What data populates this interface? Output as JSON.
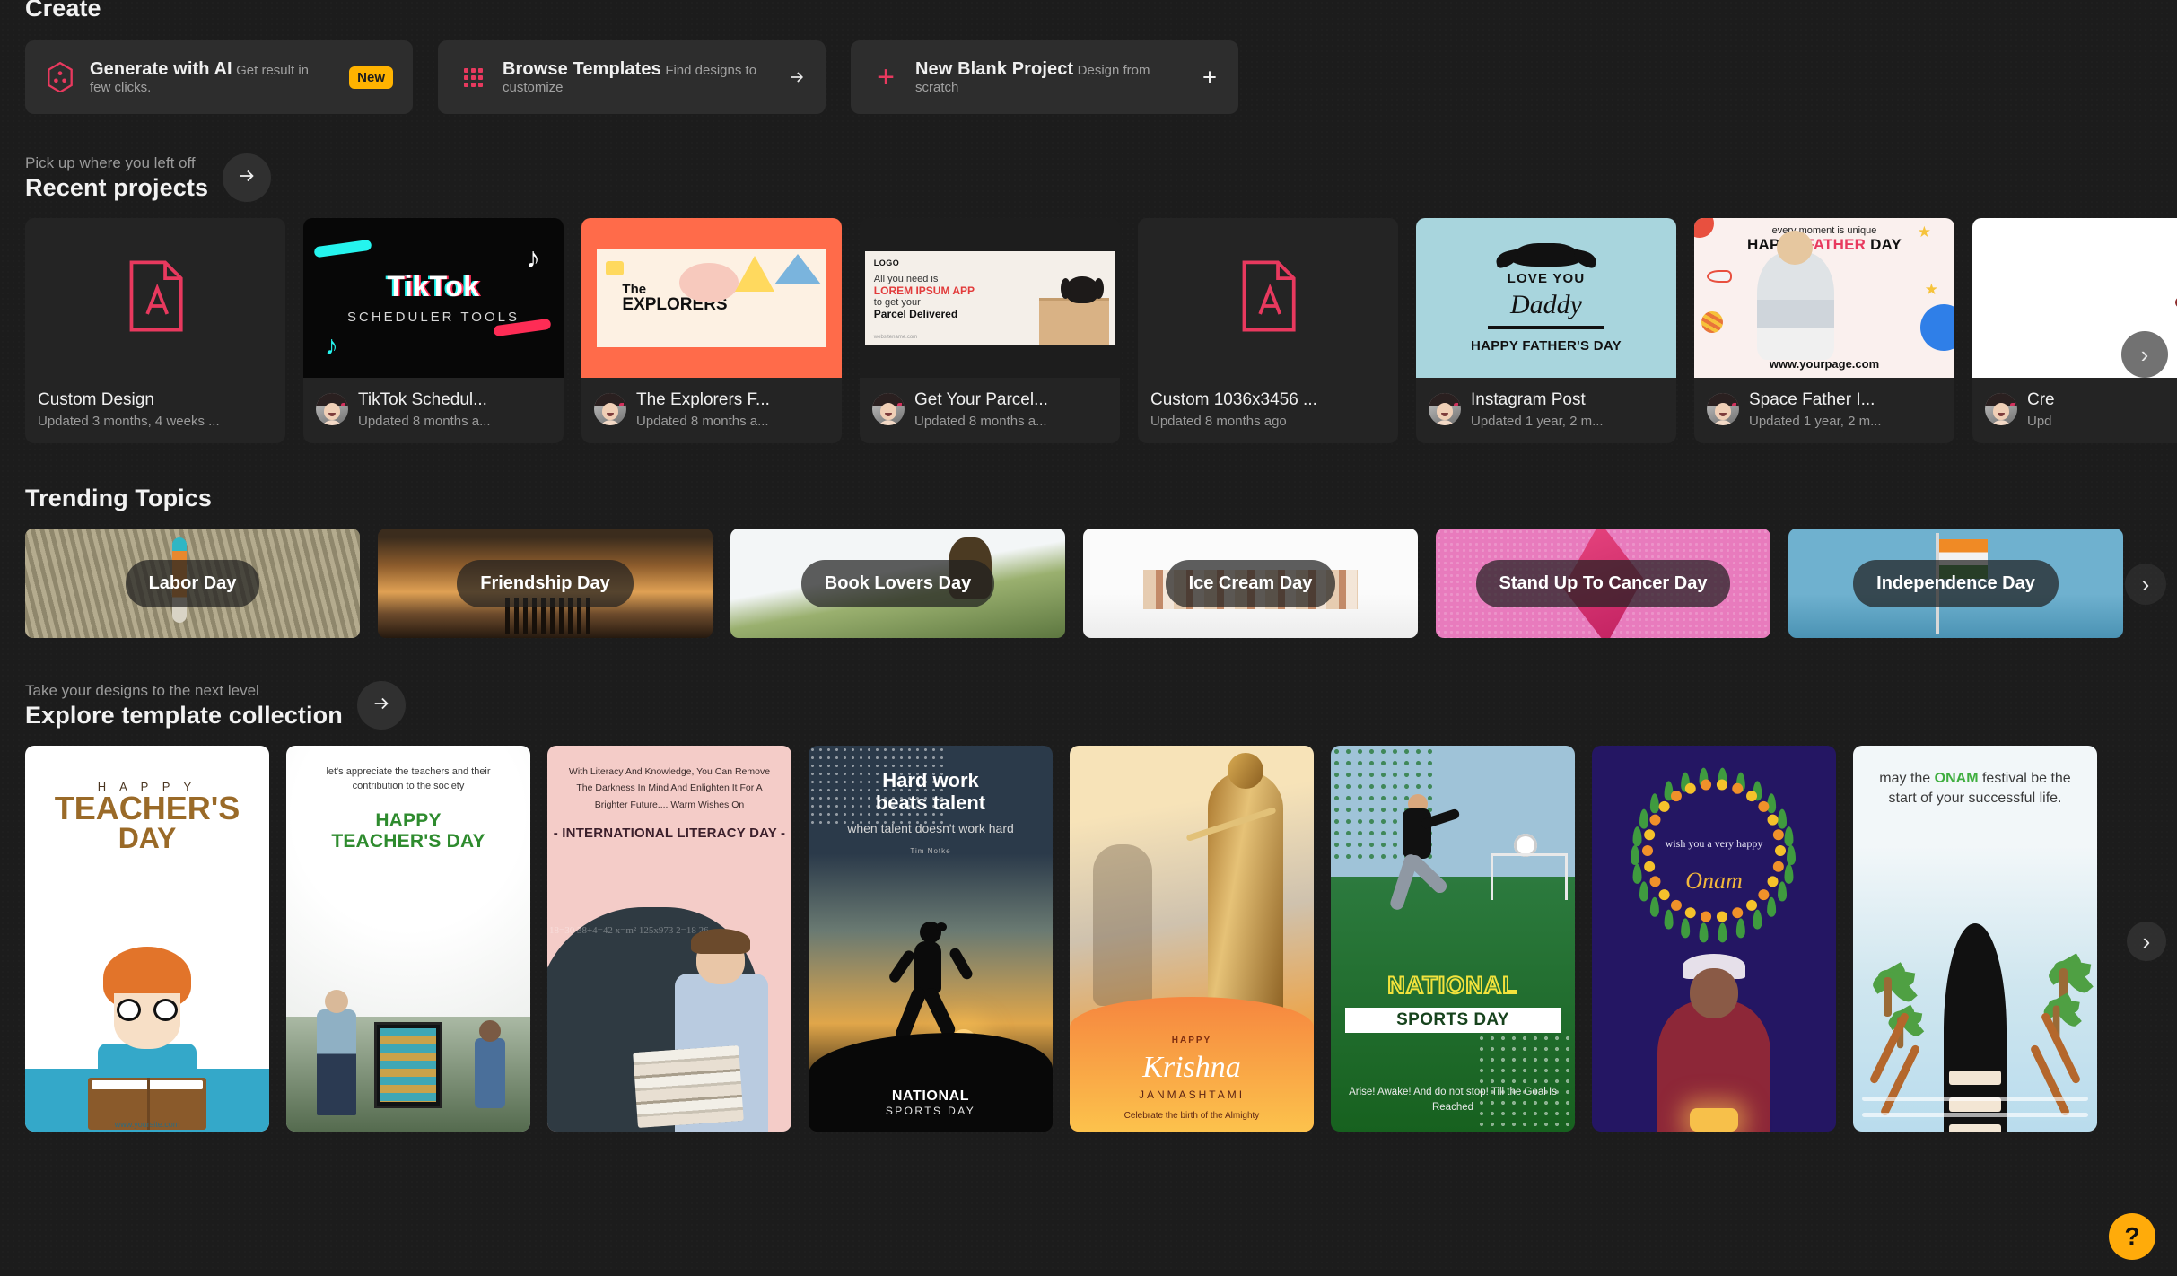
{
  "create": {
    "title": "Create",
    "cards": [
      {
        "icon": "ai-hexagon-icon",
        "title": "Generate with AI",
        "subtitle": "Get result in few clicks.",
        "badge": "New",
        "trail": ""
      },
      {
        "icon": "grid-dots-icon",
        "title": "Browse Templates",
        "subtitle": "Find designs to customize",
        "badge": "",
        "trail": "arrow-right-icon"
      },
      {
        "icon": "plus-icon",
        "title": "New Blank Project",
        "subtitle": "Design from scratch",
        "badge": "",
        "trail": "plus-icon"
      }
    ]
  },
  "recent": {
    "eyebrow": "Pick up where you left off",
    "title": "Recent projects",
    "next_arrow": "arrow-right-icon",
    "carousel_next": "chevron-right-icon",
    "projects": [
      {
        "name": "Custom Design",
        "updated": "Updated 3 months, 4 weeks ...",
        "has_avatar": false,
        "art": "doc"
      },
      {
        "name": "TikTok Schedul...",
        "updated": "Updated 8 months a...",
        "has_avatar": true,
        "art": "tiktok",
        "art_text": {
          "word": "TikTok",
          "sub": "SCHEDULER TOOLS"
        }
      },
      {
        "name": "The Explorers F...",
        "updated": "Updated 8 months a...",
        "has_avatar": true,
        "art": "explorers",
        "art_text": {
          "l1": "The",
          "l2": "EXPLORERS"
        }
      },
      {
        "name": "Get Your Parcel...",
        "updated": "Updated 8 months a...",
        "has_avatar": true,
        "art": "parcel",
        "art_text": {
          "logo": "LOGO",
          "l1": "All you need is",
          "l2": "LOREM IPSUM APP",
          "l3": "to get your",
          "l4": "Parcel Delivered",
          "url": "websitename.com"
        }
      },
      {
        "name": "Custom 1036x3456 ...",
        "updated": "Updated 8 months ago",
        "has_avatar": false,
        "art": "doc"
      },
      {
        "name": "Instagram Post",
        "updated": "Updated 1 year, 2 m...",
        "has_avatar": true,
        "art": "fathers",
        "art_text": {
          "l1": "LOVE YOU",
          "l2": "Daddy",
          "l3": "HAPPY FATHER'S DAY"
        }
      },
      {
        "name": "Space Father I...",
        "updated": "Updated 1 year, 2 m...",
        "has_avatar": true,
        "art": "space",
        "art_text": {
          "l1": "every moment is unique",
          "l2a": "HAPPY ",
          "l2b": "FATHER",
          "l2c": " DAY",
          "url": "www.yourpage.com"
        }
      },
      {
        "name": "Cre",
        "updated": "Upd",
        "has_avatar": true,
        "art": "lips"
      }
    ]
  },
  "trending": {
    "title": "Trending Topics",
    "carousel_next": "chevron-right-icon",
    "topics": [
      {
        "label": "Labor Day",
        "bg": "#9a9178"
      },
      {
        "label": "Friendship Day",
        "bg": "#c78a3c"
      },
      {
        "label": "Book Lovers Day",
        "bg": "#e3e6e4"
      },
      {
        "label": "Ice Cream Day",
        "bg": "#f2f2f2"
      },
      {
        "label": "Stand Up To Cancer Day",
        "bg": "#e87bbd"
      },
      {
        "label": "Independence Day",
        "bg": "#59a2c6"
      }
    ]
  },
  "explore": {
    "eyebrow": "Take your designs to the next level",
    "title": "Explore template collection",
    "next_arrow": "arrow-right-icon",
    "carousel_next": "chevron-right-icon",
    "templates": [
      {
        "name": "happy-teachers-day-illustration",
        "text": {
          "l1": "H A P P Y",
          "l2": "TEACHER'S",
          "l3": "DAY",
          "wm": "www.yoursite.com"
        }
      },
      {
        "name": "happy-teachers-day-photo",
        "text": {
          "q": "let's appreciate the teachers and their contribution to the society",
          "hd1": "HAPPY",
          "hd2": "TEACHER'S DAY"
        }
      },
      {
        "name": "international-literacy-day",
        "text": {
          "q": "With Literacy And Knowledge, You Can Remove The Darkness In Mind And Enlighten It For A Brighter Future.... Warm Wishes On",
          "hd": "- INTERNATIONAL LITERACY DAY -"
        }
      },
      {
        "name": "national-sports-day-running",
        "text": {
          "hd1": "Hard work",
          "hd2": "beats talent",
          "sub": "when talent doesn't work hard",
          "auth": "Tim Notke",
          "ft1": "NATIONAL",
          "ft2": "SPORTS DAY"
        }
      },
      {
        "name": "happy-krishna-janmashtami",
        "text": {
          "h1": "HAPPY",
          "h2": "Krishna",
          "h3": "JANMASHTAMI",
          "h4": "Celebrate the birth of the Almighty"
        }
      },
      {
        "name": "national-sports-day-football",
        "text": {
          "n1": "NATIONAL",
          "n2": "SPORTS DAY",
          "n3": "Arise! Awake! And do not stop! Till the Goal Is Reached"
        }
      },
      {
        "name": "happy-onam-wreath",
        "text": {
          "w1": "wish you a very happy",
          "w2": "Onam"
        }
      },
      {
        "name": "onam-festival-boat",
        "text": {
          "q1": "may the ",
          "qb": "ONAM",
          "q2": " festival be the start of your successful life."
        }
      }
    ]
  },
  "help": {
    "label": "?"
  },
  "colors": {
    "accent_pink": "#e8395e",
    "badge_yellow": "#ffb300",
    "help_yellow": "#ffab0a",
    "bg": "#1c1c1c",
    "card": "#2d2d2d"
  }
}
